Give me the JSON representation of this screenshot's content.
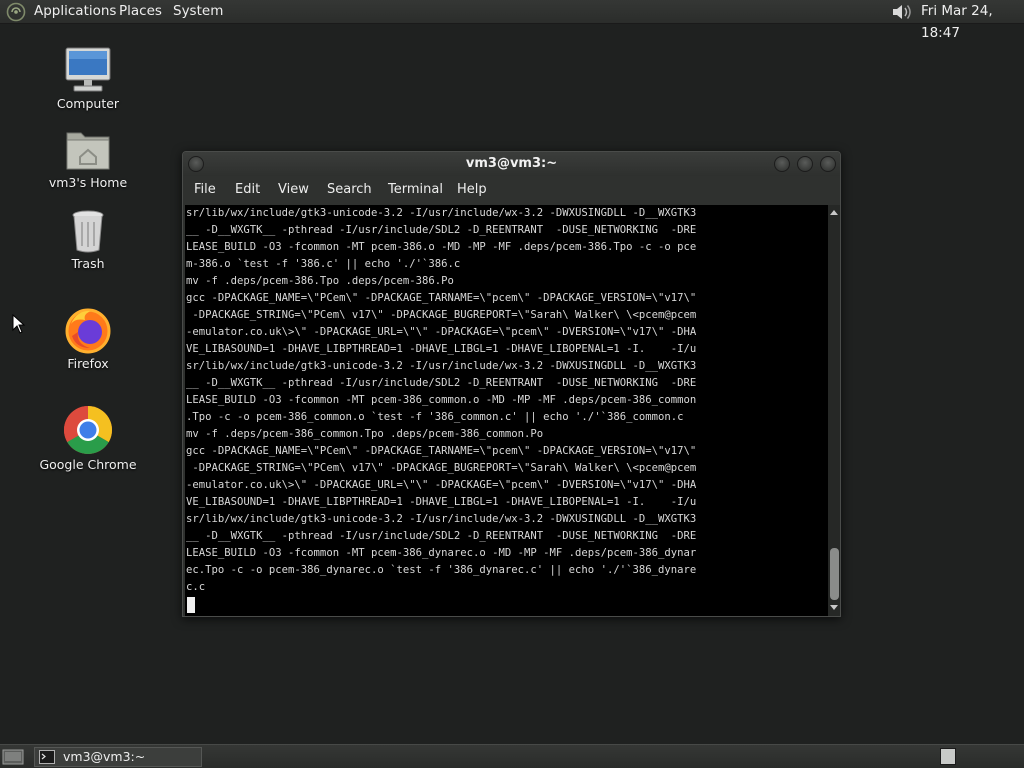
{
  "top_panel": {
    "menus": {
      "applications": "Applications",
      "places": "Places",
      "system": "System"
    },
    "clock": "Fri Mar 24, 18:47"
  },
  "desktop": {
    "icons": [
      {
        "label": "Computer"
      },
      {
        "label": "vm3's Home"
      },
      {
        "label": "Trash"
      },
      {
        "label": "Firefox"
      },
      {
        "label": "Google Chrome"
      }
    ]
  },
  "terminal": {
    "title": "vm3@vm3:~",
    "menu": [
      "File",
      "Edit",
      "View",
      "Search",
      "Terminal",
      "Help"
    ],
    "lines": [
      "sr/lib/wx/include/gtk3-unicode-3.2 -I/usr/include/wx-3.2 -DWXUSINGDLL -D__WXGTK3",
      "__ -D__WXGTK__ -pthread -I/usr/include/SDL2 -D_REENTRANT  -DUSE_NETWORKING  -DRE",
      "LEASE_BUILD -O3 -fcommon -MT pcem-386.o -MD -MP -MF .deps/pcem-386.Tpo -c -o pce",
      "m-386.o `test -f '386.c' || echo './'`386.c",
      "mv -f .deps/pcem-386.Tpo .deps/pcem-386.Po",
      "gcc -DPACKAGE_NAME=\\\"PCem\\\" -DPACKAGE_TARNAME=\\\"pcem\\\" -DPACKAGE_VERSION=\\\"v17\\\"",
      " -DPACKAGE_STRING=\\\"PCem\\ v17\\\" -DPACKAGE_BUGREPORT=\\\"Sarah\\ Walker\\ \\<pcem@pcem",
      "-emulator.co.uk\\>\\\" -DPACKAGE_URL=\\\"\\\" -DPACKAGE=\\\"pcem\\\" -DVERSION=\\\"v17\\\" -DHA",
      "VE_LIBASOUND=1 -DHAVE_LIBPTHREAD=1 -DHAVE_LIBGL=1 -DHAVE_LIBOPENAL=1 -I.    -I/u",
      "sr/lib/wx/include/gtk3-unicode-3.2 -I/usr/include/wx-3.2 -DWXUSINGDLL -D__WXGTK3",
      "__ -D__WXGTK__ -pthread -I/usr/include/SDL2 -D_REENTRANT  -DUSE_NETWORKING  -DRE",
      "LEASE_BUILD -O3 -fcommon -MT pcem-386_common.o -MD -MP -MF .deps/pcem-386_common",
      ".Tpo -c -o pcem-386_common.o `test -f '386_common.c' || echo './'`386_common.c",
      "mv -f .deps/pcem-386_common.Tpo .deps/pcem-386_common.Po",
      "gcc -DPACKAGE_NAME=\\\"PCem\\\" -DPACKAGE_TARNAME=\\\"pcem\\\" -DPACKAGE_VERSION=\\\"v17\\\"",
      " -DPACKAGE_STRING=\\\"PCem\\ v17\\\" -DPACKAGE_BUGREPORT=\\\"Sarah\\ Walker\\ \\<pcem@pcem",
      "-emulator.co.uk\\>\\\" -DPACKAGE_URL=\\\"\\\" -DPACKAGE=\\\"pcem\\\" -DVERSION=\\\"v17\\\" -DHA",
      "VE_LIBASOUND=1 -DHAVE_LIBPTHREAD=1 -DHAVE_LIBGL=1 -DHAVE_LIBOPENAL=1 -I.    -I/u",
      "sr/lib/wx/include/gtk3-unicode-3.2 -I/usr/include/wx-3.2 -DWXUSINGDLL -D__WXGTK3",
      "__ -D__WXGTK__ -pthread -I/usr/include/SDL2 -D_REENTRANT  -DUSE_NETWORKING  -DRE",
      "LEASE_BUILD -O3 -fcommon -MT pcem-386_dynarec.o -MD -MP -MF .deps/pcem-386_dynar",
      "ec.Tpo -c -o pcem-386_dynarec.o `test -f '386_dynarec.c' || echo './'`386_dynare",
      "c.c"
    ]
  },
  "taskbar": {
    "items": [
      {
        "label": "vm3@vm3:~"
      }
    ]
  }
}
